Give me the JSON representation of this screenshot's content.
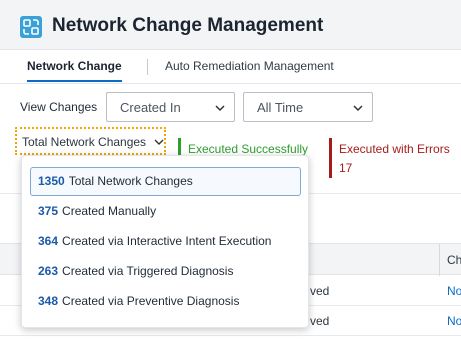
{
  "app": {
    "title": "Network Change Management",
    "icon": "network-change-icon",
    "accent": "#0a6cc7"
  },
  "tabs": [
    {
      "label": "Network Change",
      "active": true
    },
    {
      "label": "Auto Remediation Management",
      "active": false
    }
  ],
  "filters": {
    "label": "View Changes",
    "created": {
      "selected": "Created In"
    },
    "time": {
      "selected": "All Time"
    }
  },
  "total_dropdown": {
    "selected": "Total Network Changes",
    "options": [
      {
        "count": "1350",
        "label": "Total Network Changes",
        "selected": true
      },
      {
        "count": "375",
        "label": "Created Manually",
        "selected": false
      },
      {
        "count": "364",
        "label": "Created via Interactive Intent Execution",
        "selected": false
      },
      {
        "count": "263",
        "label": "Created via Triggered Diagnosis",
        "selected": false
      },
      {
        "count": "348",
        "label": "Created via Preventive Diagnosis",
        "selected": false
      }
    ]
  },
  "stats": {
    "success": {
      "label": "Executed Successfully",
      "color": "#2e9e2e"
    },
    "error": {
      "label": "Executed with Errors",
      "count": "17",
      "color": "#a61c1c"
    }
  },
  "table": {
    "header_partial": "Ch",
    "rows": [
      {
        "status_partial": "ved",
        "link_partial": "No"
      },
      {
        "status_partial": "ved",
        "link_partial": "No"
      }
    ]
  }
}
